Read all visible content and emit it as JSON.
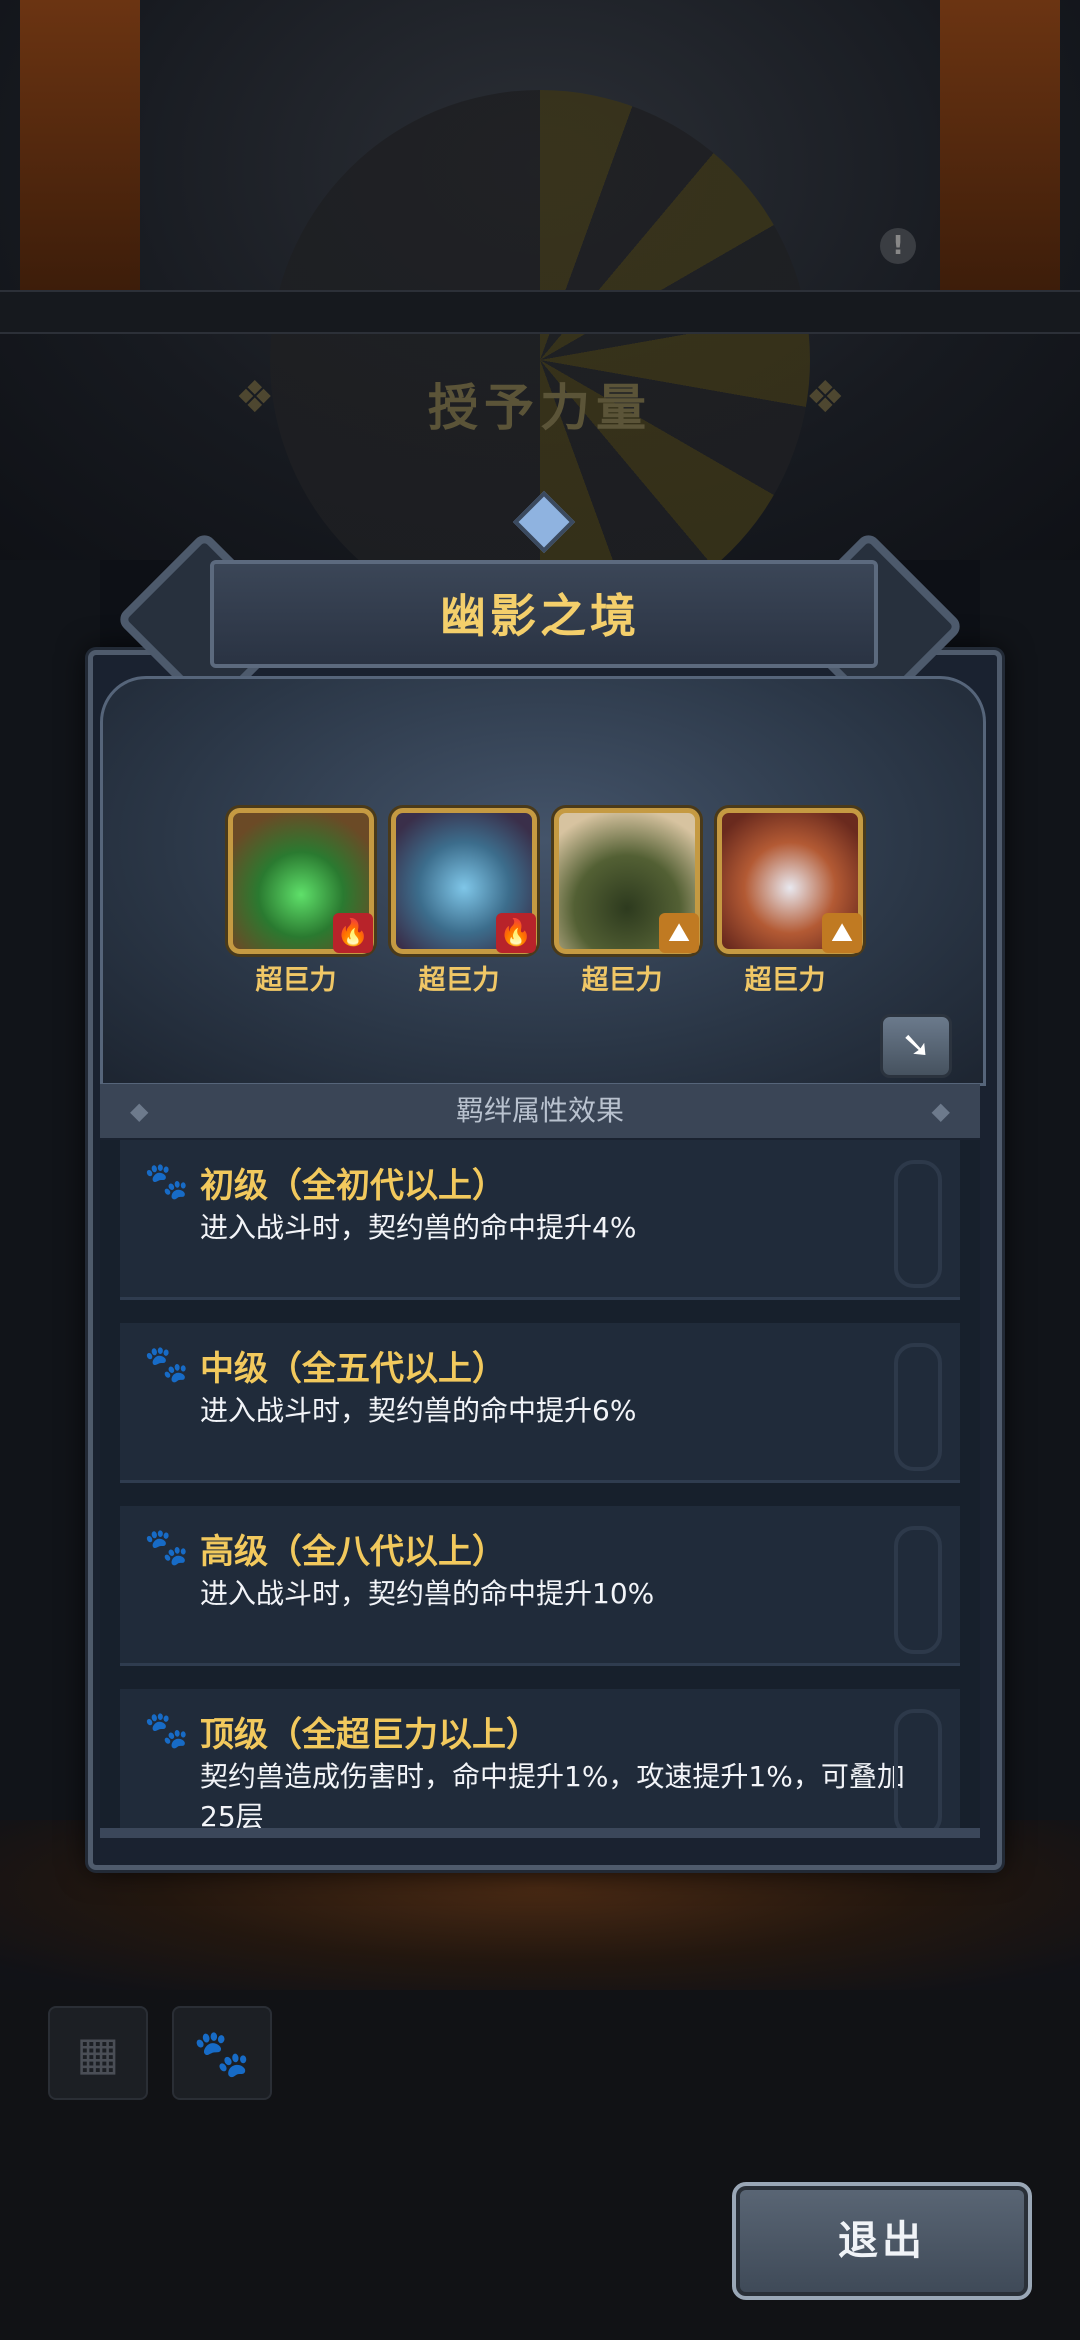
{
  "background": {
    "title": "授予力量"
  },
  "panel": {
    "title": "幽影之境",
    "pets": [
      {
        "label": "超巨力",
        "element": "fire"
      },
      {
        "label": "超巨力",
        "element": "fire"
      },
      {
        "label": "超巨力",
        "element": "earth"
      },
      {
        "label": "超巨力",
        "element": "earth"
      }
    ],
    "effects_header": "羁绊属性效果",
    "effects": [
      {
        "tier": "初级（全初代以上）",
        "desc": "进入战斗时，契约兽的命中提升4%"
      },
      {
        "tier": "中级（全五代以上）",
        "desc": "进入战斗时，契约兽的命中提升6%"
      },
      {
        "tier": "高级（全八代以上）",
        "desc": "进入战斗时，契约兽的命中提升10%"
      },
      {
        "tier": "顶级（全超巨力以上）",
        "desc": "契约兽造成伤害时，命中提升1%，攻速提升1%，可叠加25层"
      }
    ]
  },
  "footer": {
    "exit_label": "退出"
  }
}
